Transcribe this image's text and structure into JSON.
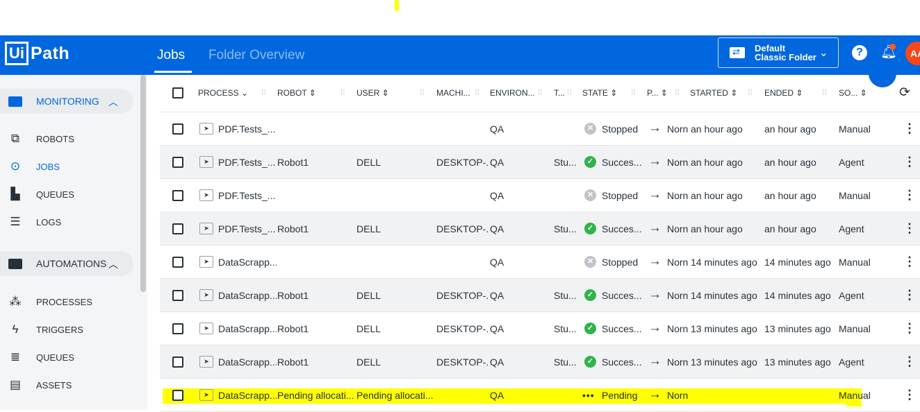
{
  "app": {
    "logo_box": "Ui",
    "logo_text": "Path",
    "tabs": [
      "Jobs",
      "Folder Overview"
    ],
    "folder": {
      "line1": "Default",
      "line2": "Classic Folder"
    },
    "help_icon": "help-icon",
    "avatar": "AA",
    "accent_color": "#0067df",
    "highlight_color": "#ffff00"
  },
  "sidebar": {
    "monitoring": {
      "label": "MONITORING",
      "items": [
        {
          "label": "ROBOTS",
          "icon": "robot-icon",
          "active": false
        },
        {
          "label": "JOBS",
          "icon": "play-circle-icon",
          "active": true
        },
        {
          "label": "QUEUES",
          "icon": "bar-chart-icon",
          "active": false
        },
        {
          "label": "LOGS",
          "icon": "lines-icon",
          "active": false
        }
      ]
    },
    "automations": {
      "label": "AUTOMATIONS",
      "items": [
        {
          "label": "PROCESSES",
          "icon": "hierarchy-icon"
        },
        {
          "label": "TRIGGERS",
          "icon": "bolt-icon"
        },
        {
          "label": "QUEUES",
          "icon": "stack-icon"
        },
        {
          "label": "ASSETS",
          "icon": "list-icon"
        }
      ]
    }
  },
  "grid": {
    "columns": [
      "PROCESS",
      "ROBOT",
      "USER",
      "MACHI...",
      "ENVIRON...",
      "T...",
      "STATE",
      "P...",
      "STARTED",
      "ENDED",
      "SO..."
    ],
    "rows": [
      {
        "process": "PDF.Tests_...",
        "robot": "",
        "user": "",
        "machine": "",
        "env": "QA",
        "type": "",
        "state": "Stopped",
        "state_kind": "stopped",
        "priority": "Norn",
        "started": "an hour ago",
        "ended": "an hour ago",
        "source": "Manual"
      },
      {
        "process": "PDF.Tests_...",
        "robot": "Robot1",
        "user": "DELL",
        "machine": "DESKTOP-...",
        "env": "QA",
        "type": "Stu...",
        "state": "Succes...",
        "state_kind": "success",
        "priority": "Norn",
        "started": "an hour ago",
        "ended": "an hour ago",
        "source": "Agent"
      },
      {
        "process": "PDF.Tests_...",
        "robot": "",
        "user": "",
        "machine": "",
        "env": "QA",
        "type": "",
        "state": "Stopped",
        "state_kind": "stopped",
        "priority": "Norn",
        "started": "an hour ago",
        "ended": "an hour ago",
        "source": "Manual"
      },
      {
        "process": "PDF.Tests_...",
        "robot": "Robot1",
        "user": "DELL",
        "machine": "DESKTOP-...",
        "env": "QA",
        "type": "Stu...",
        "state": "Succes...",
        "state_kind": "success",
        "priority": "Norn",
        "started": "an hour ago",
        "ended": "an hour ago",
        "source": "Agent"
      },
      {
        "process": "DataScrapp...",
        "robot": "",
        "user": "",
        "machine": "",
        "env": "QA",
        "type": "",
        "state": "Stopped",
        "state_kind": "stopped",
        "priority": "Norn",
        "started": "14 minutes ago",
        "ended": "14 minutes ago",
        "source": "Manual"
      },
      {
        "process": "DataScrapp...",
        "robot": "Robot1",
        "user": "DELL",
        "machine": "DESKTOP-...",
        "env": "QA",
        "type": "Stu...",
        "state": "Succes...",
        "state_kind": "success",
        "priority": "Norn",
        "started": "14 minutes ago",
        "ended": "14 minutes ago",
        "source": "Agent"
      },
      {
        "process": "DataScrapp...",
        "robot": "Robot1",
        "user": "DELL",
        "machine": "DESKTOP-...",
        "env": "QA",
        "type": "Stu...",
        "state": "Succes...",
        "state_kind": "success",
        "priority": "Norn",
        "started": "13 minutes ago",
        "ended": "13 minutes ago",
        "source": "Manual"
      },
      {
        "process": "DataScrapp...",
        "robot": "Robot1",
        "user": "DELL",
        "machine": "DESKTOP-...",
        "env": "QA",
        "type": "Stu...",
        "state": "Succes...",
        "state_kind": "success",
        "priority": "Norn",
        "started": "13 minutes ago",
        "ended": "13 minutes ago",
        "source": "Agent"
      },
      {
        "process": "DataScrapp...",
        "robot": "Pending allocati...",
        "user": "Pending allocati...",
        "machine": "",
        "env": "QA",
        "type": "",
        "state": "Pending",
        "state_kind": "pending",
        "priority": "Norn",
        "started": "",
        "ended": "",
        "source": "Manual",
        "highlighted": true
      }
    ]
  }
}
